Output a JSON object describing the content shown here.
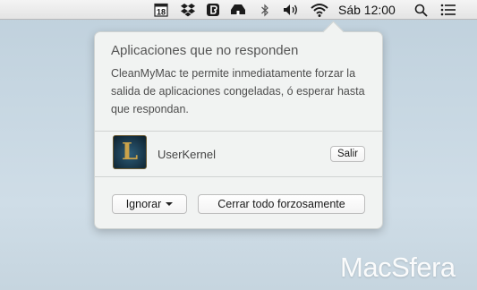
{
  "menubar": {
    "calendar_day": "18",
    "clock": "Sáb 12:00",
    "icons": [
      "calendar-icon",
      "dropbox-icon",
      "evernote-icon",
      "cleanmymac-icon",
      "bluetooth-icon",
      "volume-icon",
      "wifi-icon",
      "search-icon",
      "list-icon"
    ]
  },
  "popover": {
    "title": "Aplicaciones que no responden",
    "description": "CleanMyMac te permite inmediatamente forzar la salida de aplicaciones congeladas, ó esperar hasta que respondan.",
    "app": {
      "name": "UserKernel",
      "icon_letter": "L",
      "quit_button": "Salir"
    },
    "ignore_button": "Ignorar",
    "force_quit_all_button": "Cerrar todo forzosamente"
  },
  "watermark": "MacSfera"
}
